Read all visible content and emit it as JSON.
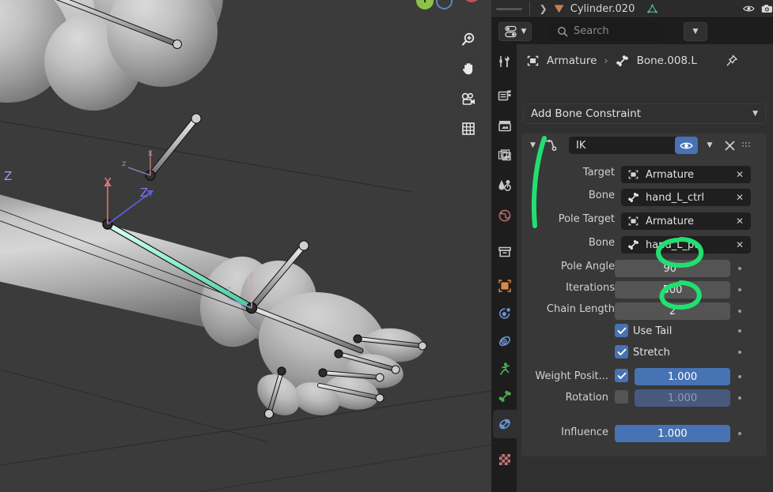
{
  "viewport": {
    "name": "3d-viewport",
    "background_color": "#3b3b3b",
    "gizmo": {
      "axes": [
        {
          "label": "Y",
          "color": "#8bc34a",
          "filled": true
        },
        {
          "label": "",
          "color": "#5988c4",
          "filled": false
        },
        {
          "label": "",
          "color": "#c44f55",
          "filled": true
        }
      ]
    },
    "tools": [
      {
        "name": "zoom-tool",
        "icon": "magnifier-plus-icon"
      },
      {
        "name": "pan-tool",
        "icon": "hand-icon"
      },
      {
        "name": "camera-tool",
        "icon": "camera-icon"
      },
      {
        "name": "grid-tool",
        "icon": "grid-icon"
      }
    ],
    "axis_labels": {
      "x": "X",
      "z": "Z",
      "x_small": "x",
      "z_small": "z",
      "z_left": "Z"
    }
  },
  "outliner": {
    "expand_icon": "chevron-right-icon",
    "object_icon": "mesh-data-icon",
    "object_name": "Cylinder.020",
    "data_icon": "mesh-triangle-icon",
    "visibility_icon": "eye-icon",
    "render_icon": "camera-icon"
  },
  "properties": {
    "header": {
      "filter_icon": "toggle-filter-icon",
      "filter_chevron": "chevron-down-icon",
      "search": {
        "placeholder": "Search",
        "value": "",
        "icon": "search-icon"
      },
      "options_chevron": "chevron-down-icon"
    },
    "tabs": [
      {
        "name": "tool",
        "icon": "tool-icon",
        "color": "#c8c8c8",
        "active": false
      },
      {
        "name": "render",
        "icon": "render-camera-icon",
        "color": "#c8c8c8",
        "active": false
      },
      {
        "name": "output",
        "icon": "printer-icon",
        "color": "#c8c8c8",
        "active": false
      },
      {
        "name": "view-layer",
        "icon": "images-icon",
        "color": "#c8c8c8",
        "active": false
      },
      {
        "name": "scene",
        "icon": "scene-cone-icon",
        "color": "#c8c8c8",
        "active": false
      },
      {
        "name": "world",
        "icon": "world-globe-icon",
        "color": "#b06a6a",
        "active": false
      },
      {
        "name": "collection",
        "icon": "collection-box-icon",
        "color": "#c8c8c8",
        "active": false
      },
      {
        "name": "object",
        "icon": "object-square-icon",
        "color": "#dd8a46",
        "active": false
      },
      {
        "name": "modifiers",
        "icon": "wrench-orbit-icon",
        "color": "#6b93d6",
        "active": false
      },
      {
        "name": "physics",
        "icon": "physics-orbit-icon",
        "color": "#6b93d6",
        "active": false
      },
      {
        "name": "object-constraints",
        "icon": "constraint-person-icon",
        "color": "#4caf50",
        "active": false
      },
      {
        "name": "armature-data",
        "icon": "bone-icon",
        "color": "#4caf50",
        "active": false
      },
      {
        "name": "bone-constraints",
        "icon": "bone-constraint-icon",
        "color": "#6b93d6",
        "active": true
      },
      {
        "name": "texture",
        "icon": "checker-icon",
        "color": "#c07a7a",
        "active": false
      }
    ],
    "breadcrumb": {
      "armature_icon": "object-data-icon",
      "armature_label": "Armature",
      "separator": "›",
      "bone_icon": "bone-icon",
      "bone_label": "Bone.008.L",
      "pin_icon": "pin-icon"
    },
    "add_constraint": {
      "label": "Add Bone Constraint",
      "chevron": "chevron-down-icon"
    },
    "constraint": {
      "collapse_icon": "chevron-down-icon",
      "type_icon": "ik-constraint-icon",
      "name": "IK",
      "enable_icon": "eye-icon",
      "extras_icon": "chevron-down-icon",
      "delete_icon": "x-icon",
      "drag_icon": "grip-dots-icon",
      "fields": [
        {
          "label": "Target",
          "type": "object-field",
          "icon": "object-data-icon",
          "value": "Armature",
          "clear_icon": "x-icon"
        },
        {
          "label": "Bone",
          "type": "bone-field",
          "icon": "bone-icon",
          "value": "hand_L_ctrl",
          "clear_icon": "x-icon"
        },
        {
          "label": "Pole Target",
          "type": "object-field",
          "icon": "object-data-icon",
          "value": "Armature",
          "clear_icon": "x-icon"
        },
        {
          "label": "Bone",
          "type": "bone-field",
          "icon": "bone-icon",
          "value": "hand_L_pt",
          "clear_icon": "x-icon"
        }
      ],
      "numbers": [
        {
          "label": "Pole Angle",
          "value": "90°",
          "animatable": true
        },
        {
          "label": "Iterations",
          "value": "500",
          "animatable": true
        },
        {
          "label": "Chain Length",
          "value": "2",
          "animatable": true
        }
      ],
      "checkboxes": [
        {
          "label": "Use Tail",
          "checked": true,
          "animatable": true
        },
        {
          "label": "Stretch",
          "checked": true,
          "animatable": true
        }
      ],
      "weights": [
        {
          "label": "Weight Posit...",
          "checked": true,
          "value": "1.000",
          "enabled": true,
          "animatable": true
        },
        {
          "label": "Rotation",
          "checked": false,
          "value": "1.000",
          "enabled": false,
          "animatable": true
        }
      ],
      "influence": {
        "label": "Influence",
        "value": "1.000",
        "animatable": true
      }
    }
  },
  "annotations": {
    "color": "#21e070",
    "marks": [
      {
        "name": "bracket-target-fields",
        "shape": "arc"
      },
      {
        "name": "circle-pole-angle",
        "shape": "ellipse"
      },
      {
        "name": "circle-chain-length",
        "shape": "ellipse"
      }
    ]
  }
}
